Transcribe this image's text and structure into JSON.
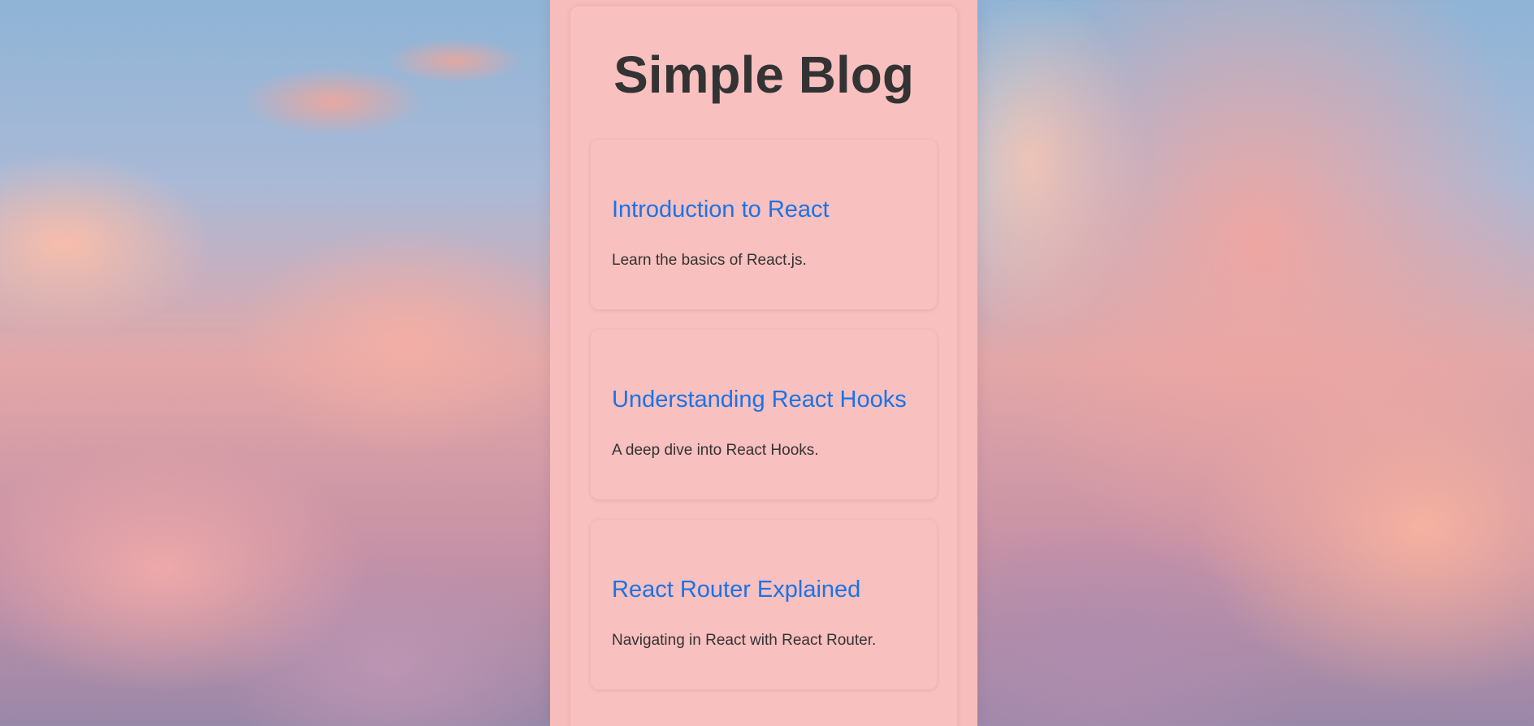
{
  "blog": {
    "title": "Simple Blog",
    "posts": [
      {
        "title": "Introduction to React",
        "excerpt": "Learn the basics of React.js."
      },
      {
        "title": "Understanding React Hooks",
        "excerpt": "A deep dive into React Hooks."
      },
      {
        "title": "React Router Explained",
        "excerpt": "Navigating in React with React Router."
      }
    ]
  },
  "colors": {
    "panel": "#f7bcbc",
    "link": "#1a73e8",
    "text": "#333333"
  }
}
